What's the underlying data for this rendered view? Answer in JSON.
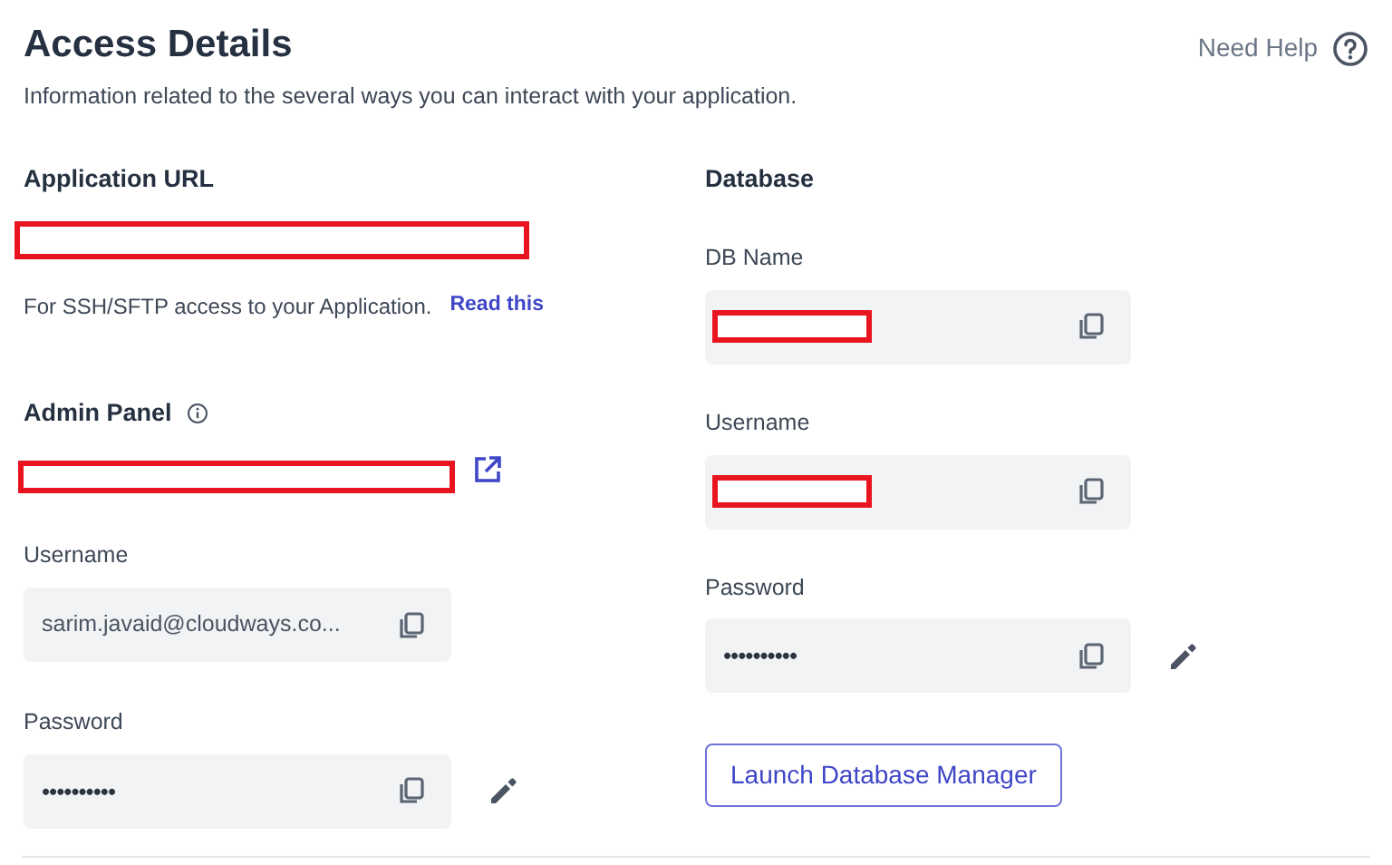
{
  "header": {
    "title": "Access Details",
    "subtitle": "Information related to the several ways you can interact with your application.",
    "help_link": "Need Help"
  },
  "application_url": {
    "heading": "Application URL",
    "url_redacted": true,
    "note": "For SSH/SFTP access to your Application.",
    "link": "Read this"
  },
  "admin_panel": {
    "heading": "Admin Panel",
    "url_redacted": true,
    "fields": [
      {
        "label": "Username",
        "kind": "text",
        "value": "sarim.javaid@cloudways.co...",
        "editable": false
      },
      {
        "label": "Password",
        "kind": "password",
        "value": "••••••••••",
        "editable": true
      }
    ]
  },
  "database": {
    "heading": "Database",
    "fields": [
      {
        "label": "DB Name",
        "kind": "redacted",
        "editable": false
      },
      {
        "label": "Username",
        "kind": "redacted",
        "editable": false
      },
      {
        "label": "Password",
        "kind": "password",
        "value": "••••••••••",
        "editable": true
      }
    ],
    "button": "Launch Database Manager"
  }
}
